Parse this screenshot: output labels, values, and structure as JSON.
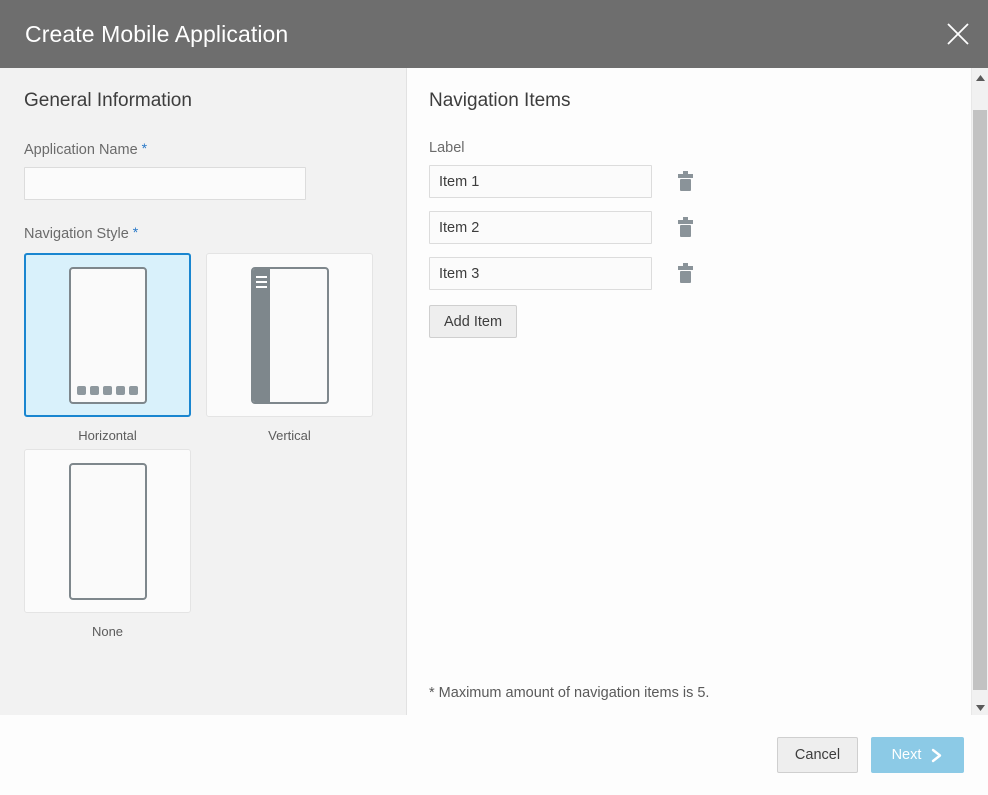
{
  "titlebar": {
    "title": "Create Mobile Application",
    "close_icon": "close-icon"
  },
  "left_panel": {
    "heading": "General Information",
    "app_name": {
      "label": "Application Name",
      "required_mark": "*",
      "value": "",
      "placeholder": ""
    },
    "nav_style": {
      "label": "Navigation Style",
      "required_mark": "*",
      "selected": "Horizontal",
      "options": [
        {
          "caption": "Horizontal",
          "icon": "phone-horizontal-nav-icon",
          "selected": true
        },
        {
          "caption": "Vertical",
          "icon": "phone-vertical-nav-icon",
          "selected": false
        },
        {
          "caption": "None",
          "icon": "phone-no-nav-icon",
          "selected": false
        }
      ]
    }
  },
  "right_panel": {
    "heading": "Navigation Items",
    "column_label": "Label",
    "items": [
      {
        "value": "Item 1",
        "delete_icon": "trash-icon"
      },
      {
        "value": "Item 2",
        "delete_icon": "trash-icon"
      },
      {
        "value": "Item 3",
        "delete_icon": "trash-icon"
      }
    ],
    "add_item_label": "Add Item",
    "max_note": "* Maximum amount of navigation items is 5."
  },
  "scrollbar": {
    "up_icon": "caret-up-icon",
    "down_icon": "caret-down-icon"
  },
  "footer": {
    "cancel_label": "Cancel",
    "next_label": "Next",
    "next_icon": "chevron-right-icon"
  },
  "colors": {
    "titlebar_bg": "#6e6e6e",
    "panel_bg": "#f2f2f2",
    "accent_blue": "#1a86d0",
    "selected_card_bg": "#d9f1fb",
    "required_star": "#2878c8",
    "next_button_bg": "#8ccae6"
  }
}
